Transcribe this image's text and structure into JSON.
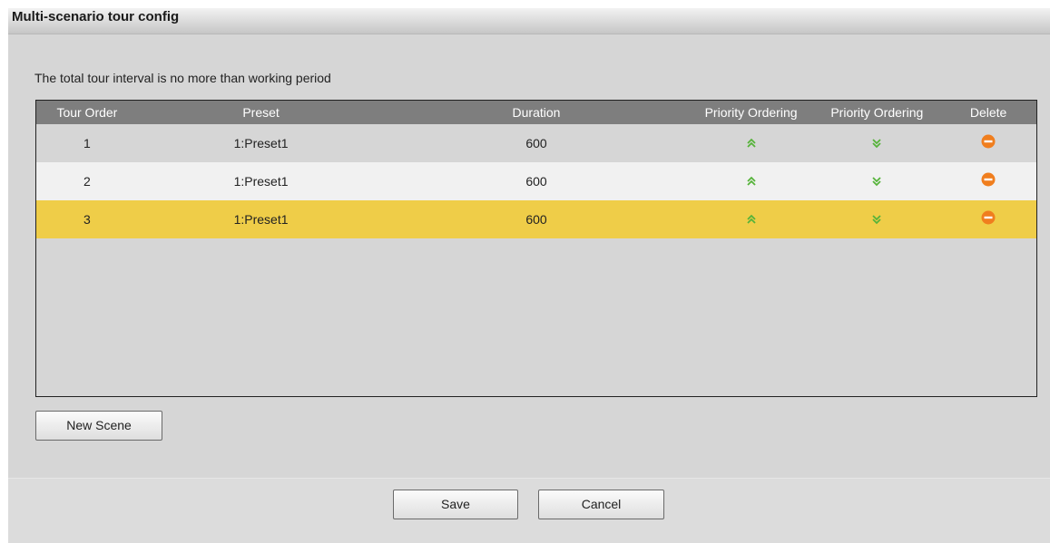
{
  "dialog": {
    "title": "Multi-scenario tour config",
    "note": "The total tour interval is no more than working period"
  },
  "table": {
    "columns": [
      "Tour Order",
      "Preset",
      "Duration",
      "Priority Ordering",
      "Priority Ordering",
      "Delete"
    ],
    "rows": [
      {
        "order": "1",
        "preset": "1:Preset1",
        "duration": "600"
      },
      {
        "order": "2",
        "preset": "1:Preset1",
        "duration": "600"
      },
      {
        "order": "3",
        "preset": "1:Preset1",
        "duration": "600"
      }
    ],
    "selected_row": 3,
    "icons": {
      "move_up": "double-chevron-up-icon",
      "move_down": "double-chevron-down-icon",
      "delete": "minus-circle-icon"
    }
  },
  "buttons": {
    "new_scene": "New Scene",
    "save": "Save",
    "cancel": "Cancel"
  },
  "colors": {
    "header_bg": "#7e7e7e",
    "selected_row": "#efcd48",
    "chevron_green": "#56b33a",
    "delete_orange": "#f07e1e"
  }
}
